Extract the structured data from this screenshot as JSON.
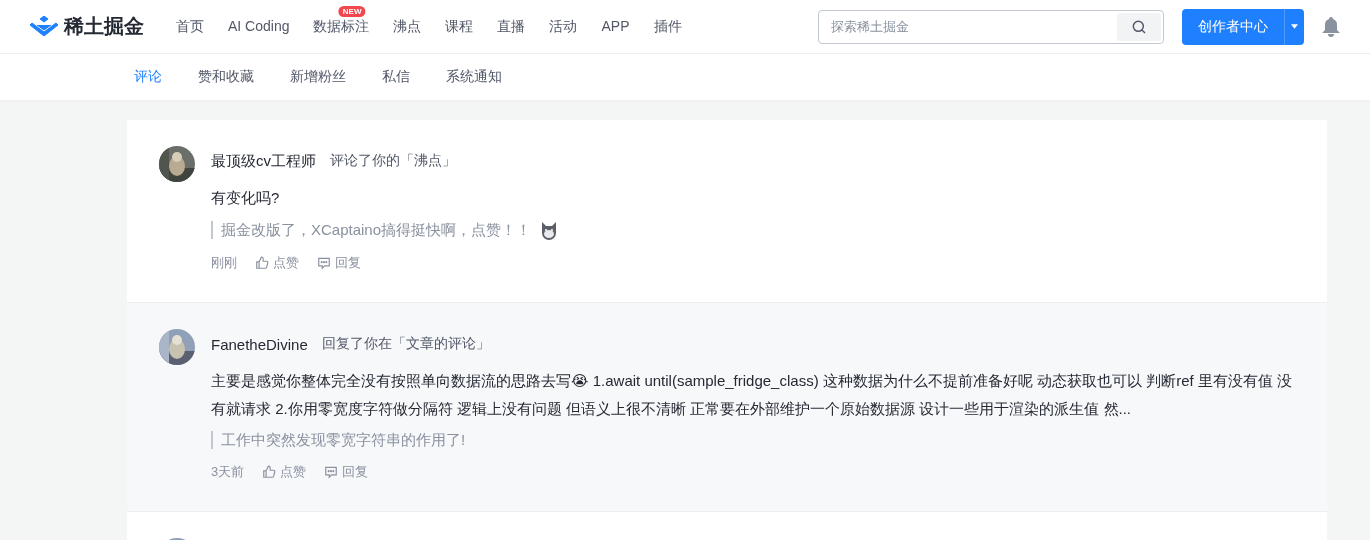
{
  "header": {
    "logo_text": "稀土掘金",
    "nav": [
      {
        "label": "首页"
      },
      {
        "label": "AI Coding"
      },
      {
        "label": "数据标注",
        "badge": "NEW"
      },
      {
        "label": "沸点"
      },
      {
        "label": "课程"
      },
      {
        "label": "直播"
      },
      {
        "label": "活动"
      },
      {
        "label": "APP"
      },
      {
        "label": "插件"
      }
    ],
    "search": {
      "placeholder": "探索稀土掘金"
    },
    "creator_button": "创作者中心"
  },
  "tabs": [
    {
      "label": "评论",
      "selected": true
    },
    {
      "label": "赞和收藏",
      "selected": false
    },
    {
      "label": "新增粉丝",
      "selected": false
    },
    {
      "label": "私信",
      "selected": false
    },
    {
      "label": "系统通知",
      "selected": false
    }
  ],
  "comments": [
    {
      "user": "最顶级cv工程师",
      "action": "评论了你的「沸点」",
      "text": "有变化吗?",
      "quote": "掘金改版了，XCaptaino搞得挺快啊，点赞！！",
      "quote_sticker": true,
      "time": "刚刚",
      "like": "点赞",
      "reply": "回复",
      "hovered": false
    },
    {
      "user": "FanetheDivine",
      "action": "回复了你在「文章的评论」",
      "text": "主要是感觉你整体完全没有按照单向数据流的思路去写😭 1.await until(sample_fridge_class) 这种数据为什么不提前准备好呢 动态获取也可以 判断ref 里有没有值 没有就请求 2.你用零宽度字符做分隔符 逻辑上没有问题 但语义上很不清晰 正常要在外部维护一个原始数据源 设计一些用于渲染的派生值 然...",
      "quote": "工作中突然发现零宽字符串的作用了!",
      "quote_sticker": false,
      "time": "3天前",
      "like": "点赞",
      "reply": "回复",
      "hovered": true
    }
  ]
}
